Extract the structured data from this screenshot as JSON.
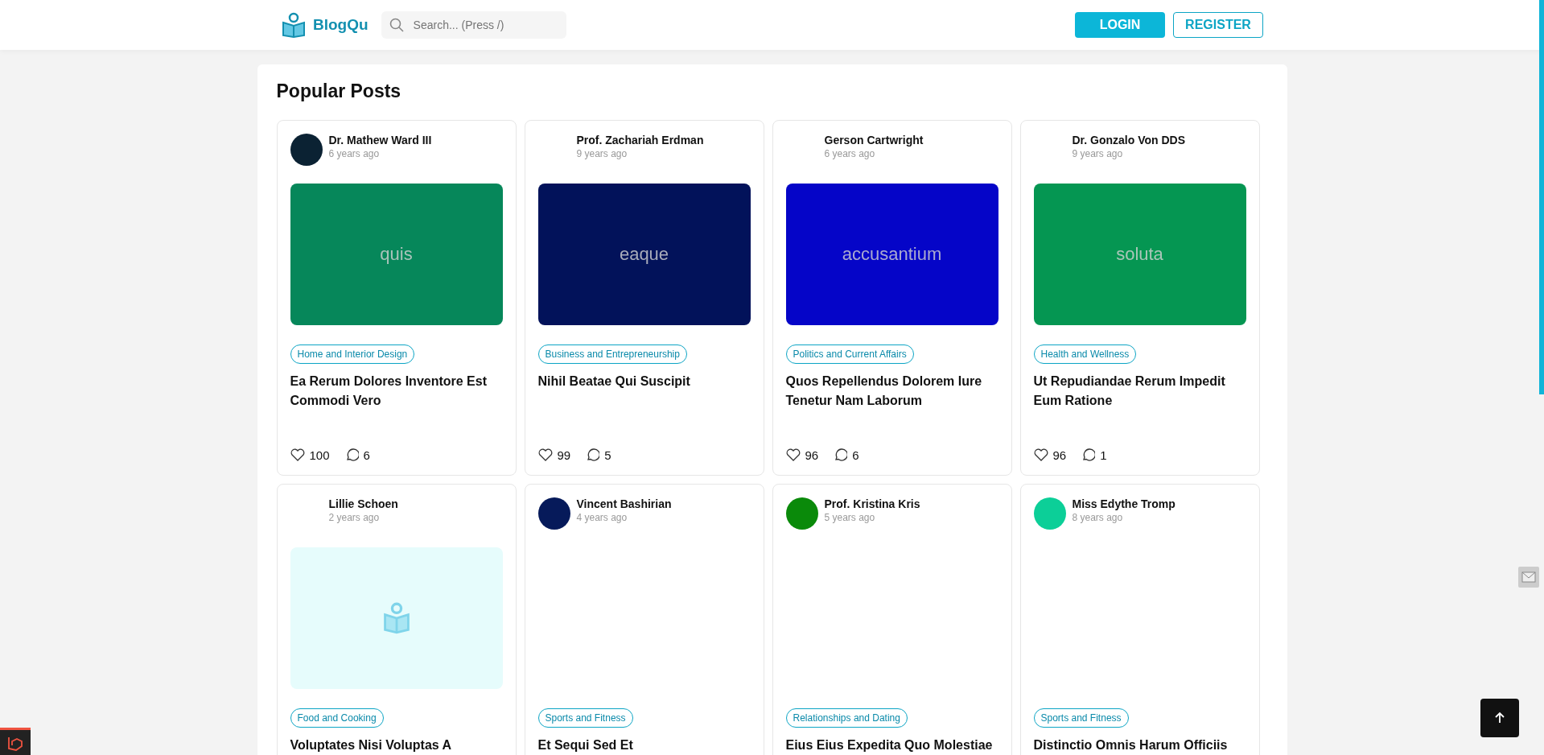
{
  "header": {
    "logo": "BlogQu",
    "search": {
      "placeholder": "Search... (Press /)"
    },
    "login": "LOGIN",
    "register": "REGISTER"
  },
  "section_title": "Popular Posts",
  "posts": [
    {
      "author": "Dr. Mathew Ward III",
      "time": "6 years ago",
      "avatar": {
        "color": "#0b2233"
      },
      "image": {
        "kind": "color",
        "color": "#06875a",
        "text": "quis"
      },
      "category": "Home and Interior Design",
      "title": "Ea Rerum Dolores Inventore Est Commodi Vero",
      "likes": "100",
      "comments": "6"
    },
    {
      "author": "Prof. Zachariah Erdman",
      "time": "9 years ago",
      "image": {
        "kind": "color",
        "color": "#02125a",
        "text": "eaque"
      },
      "category": "Business and Entrepreneurship",
      "title": "Nihil Beatae Qui Suscipit",
      "likes": "99",
      "comments": "5"
    },
    {
      "author": "Gerson Cartwright",
      "time": "6 years ago",
      "image": {
        "kind": "color",
        "color": "#0505c8",
        "text": "accusantium"
      },
      "category": "Politics and Current Affairs",
      "title": "Quos Repellendus Dolorem Iure Tenetur Nam Laborum",
      "likes": "96",
      "comments": "6"
    },
    {
      "author": "Dr. Gonzalo Von DDS",
      "time": "9 years ago",
      "image": {
        "kind": "color",
        "color": "#059652",
        "text": "soluta"
      },
      "category": "Health and Wellness",
      "title": "Ut Repudiandae Rerum Impedit Eum Ratione",
      "likes": "96",
      "comments": "1"
    },
    {
      "author": "Lillie Schoen",
      "time": "2 years ago",
      "image": {
        "kind": "placeholder"
      },
      "category": "Food and Cooking",
      "title": "Voluptates Nisi Voluptas A"
    },
    {
      "author": "Vincent Bashirian",
      "time": "4 years ago",
      "avatar": {
        "color": "#061a5a"
      },
      "image": {
        "kind": "blank"
      },
      "category": "Sports and Fitness",
      "title": "Et Sequi Sed Et"
    },
    {
      "author": "Prof. Kristina Kris",
      "time": "5 years ago",
      "avatar": {
        "color": "#0a8a0a"
      },
      "image": {
        "kind": "blank"
      },
      "category": "Relationships and Dating",
      "title": "Eius Eius Expedita Quo Molestiae"
    },
    {
      "author": "Miss Edythe Tromp",
      "time": "8 years ago",
      "avatar": {
        "color": "#0ccf98"
      },
      "image": {
        "kind": "blank"
      },
      "category": "Sports and Fitness",
      "title": "Distinctio Omnis Harum Officiis"
    }
  ]
}
